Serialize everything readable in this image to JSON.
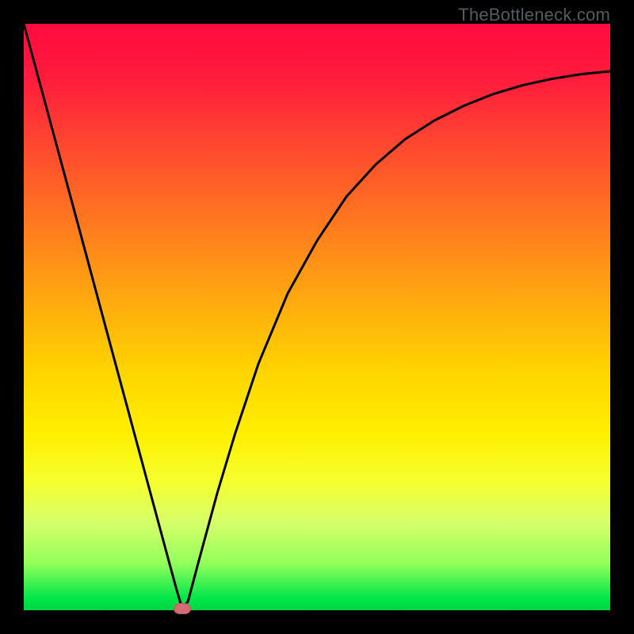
{
  "attribution": "TheBottleneck.com",
  "chart_data": {
    "type": "line",
    "title": "",
    "xlabel": "",
    "ylabel": "",
    "xlim": [
      0,
      100
    ],
    "ylim": [
      0,
      100
    ],
    "grid": false,
    "legend": false,
    "series": [
      {
        "name": "bottleneck-curve",
        "x": [
          0,
          5,
          10,
          15,
          20,
          24,
          26,
          27,
          28,
          30,
          33,
          36,
          40,
          45,
          50,
          55,
          60,
          65,
          70,
          75,
          80,
          85,
          90,
          95,
          100
        ],
        "values": [
          100,
          81.5,
          63,
          44.4,
          25.9,
          11.1,
          3.7,
          0.3,
          1.5,
          9,
          20,
          30,
          42,
          54,
          63,
          70.5,
          76,
          80.3,
          83.5,
          86,
          88,
          89.5,
          90.6,
          91.4,
          91.9
        ]
      }
    ],
    "marker": {
      "x": 27,
      "y": 0.3
    },
    "background_gradient": {
      "top": "#ff0a40",
      "mid1": "#ff8f18",
      "mid2": "#ffef00",
      "bottom": "#00d642"
    },
    "notes": "V-shaped curve on a vertical red-to-green gradient background; minimum near x≈27% with a small pink marker at the bottom."
  }
}
